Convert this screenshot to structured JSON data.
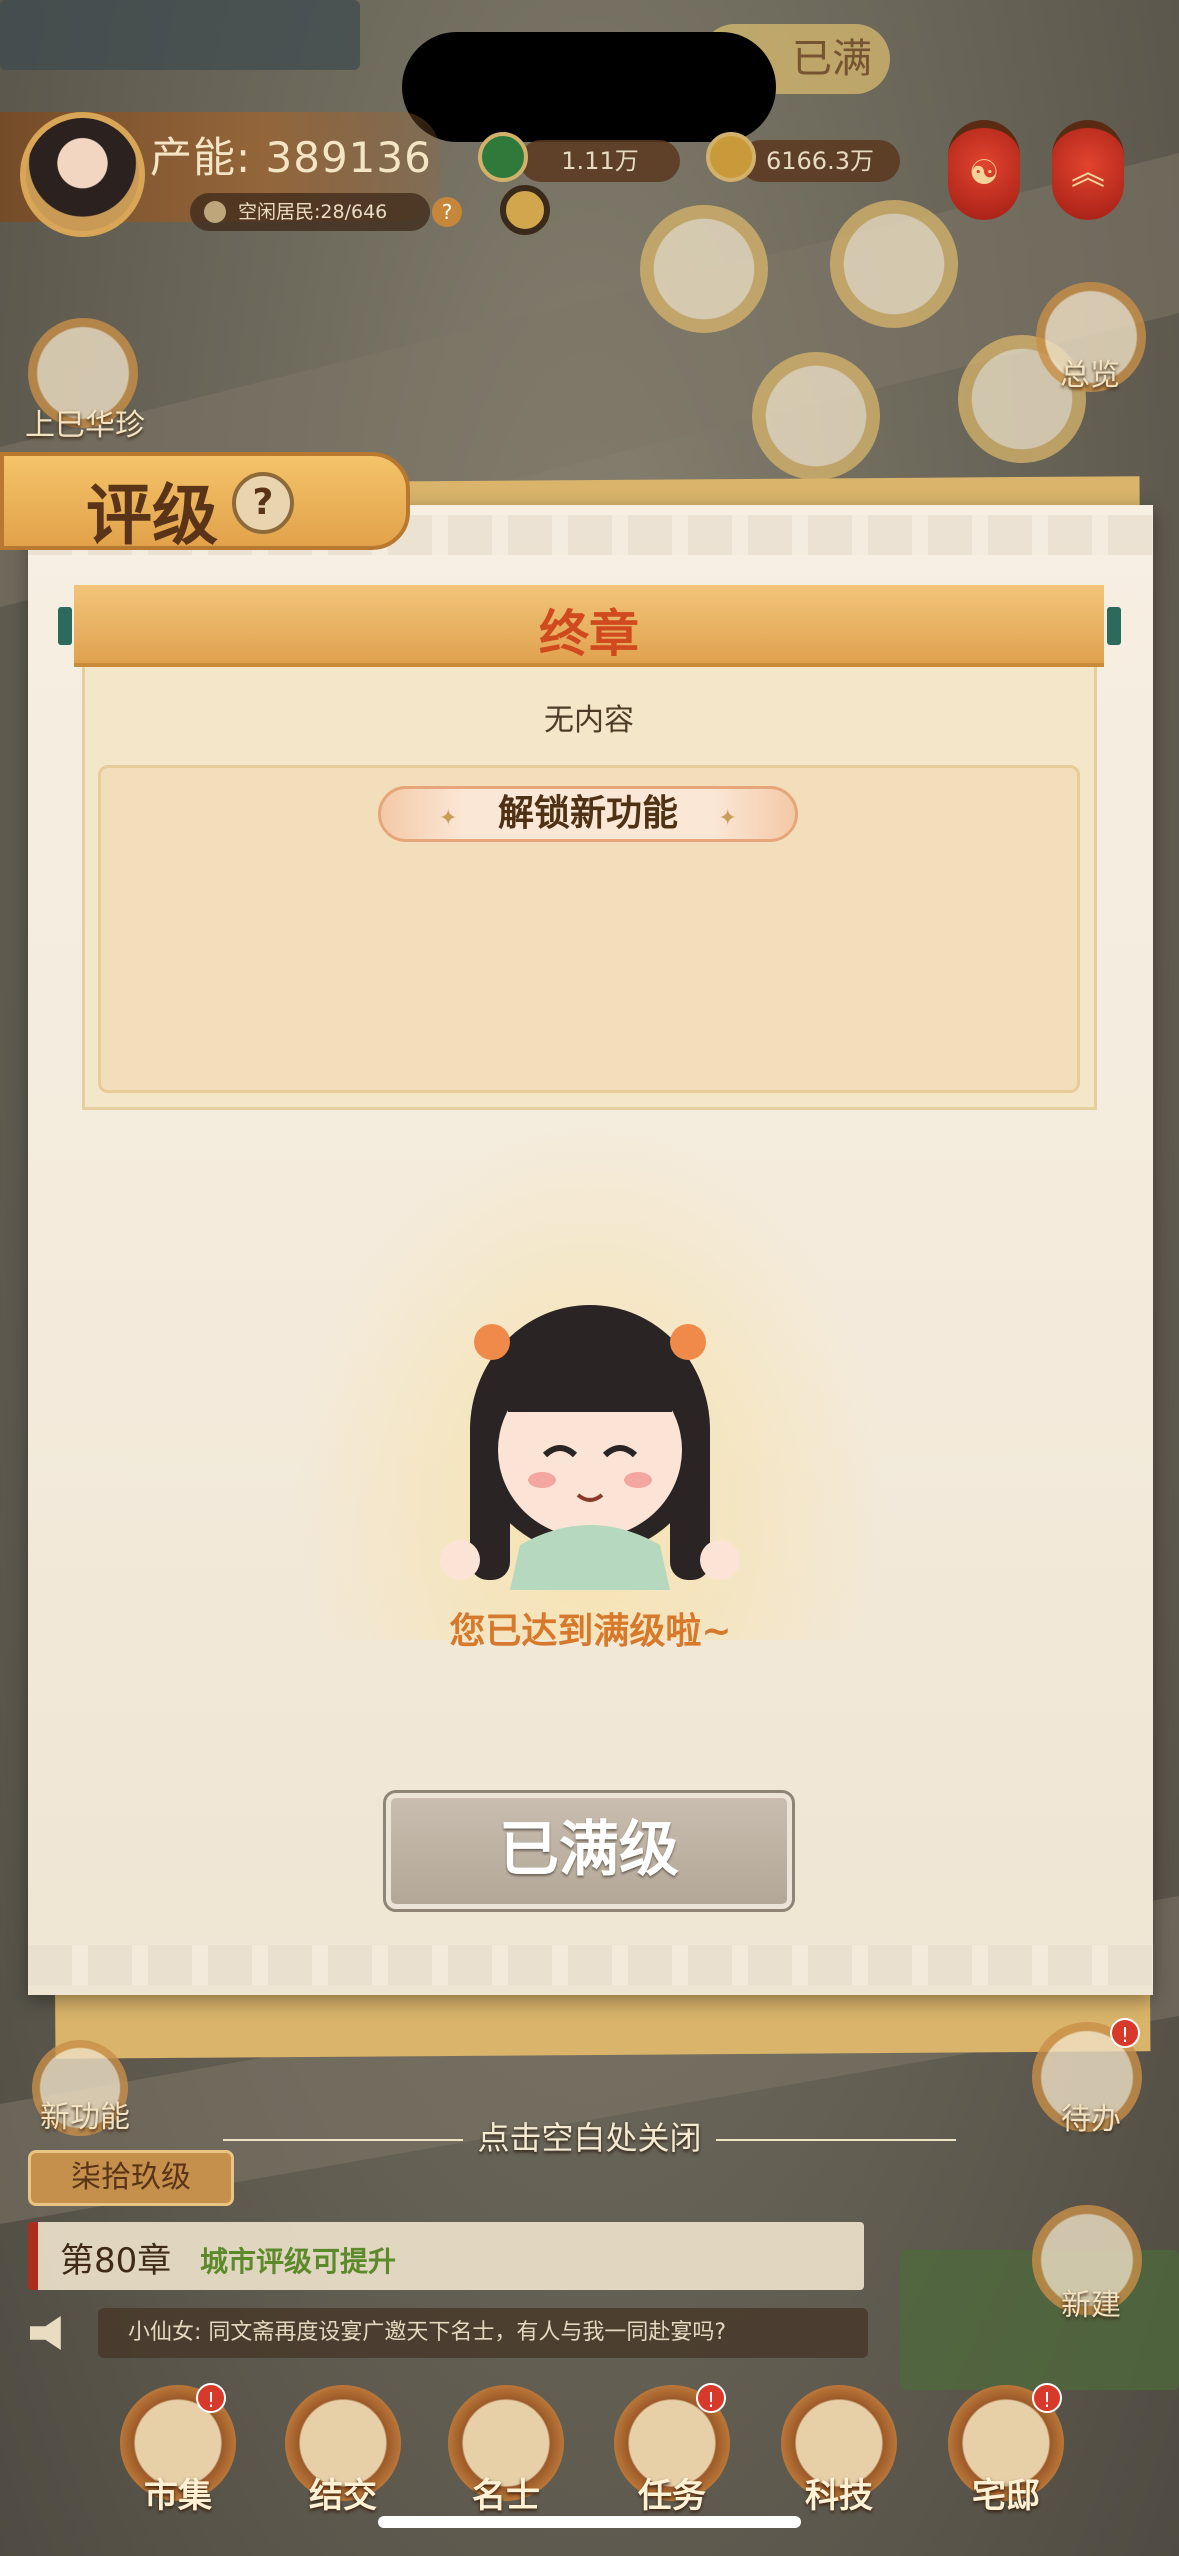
{
  "hud": {
    "production_label": "产能: 389136",
    "idle_residents": "空闲居民:28/646",
    "help": "?",
    "resource_1": "1.11万",
    "resource_2": "6166.3万",
    "top_banner": "已满"
  },
  "side": {
    "festival_label": "上巳华珍",
    "overview_label": "总览",
    "new_feature_label": "新功能",
    "todo_label": "待办",
    "build_label": "新建"
  },
  "modal": {
    "title": "评级",
    "help": "?",
    "chapter_title": "终章",
    "no_content": "无内容",
    "unlock_label": "解锁新功能",
    "max_text": "您已达到满级啦~",
    "maxed_button": "已满级"
  },
  "bottom": {
    "close_hint": "点击空白处关闭",
    "rank_label": "柒拾玖级",
    "chapter_num": "第80章",
    "chapter_hint": "城市评级可提升",
    "chat_message": "小仙女: 同文斋再度设宴广邀天下名士，有人与我一同赴宴吗?"
  },
  "nav": [
    {
      "label": "市集",
      "badge": "!"
    },
    {
      "label": "结交",
      "badge": ""
    },
    {
      "label": "名士",
      "badge": ""
    },
    {
      "label": "任务",
      "badge": "!"
    },
    {
      "label": "科技",
      "badge": ""
    },
    {
      "label": "宅邸",
      "badge": "!"
    }
  ],
  "colors": {
    "accent_orange": "#d6792c",
    "chapter_red": "#d04a1e",
    "paper": "#f6efe2"
  }
}
